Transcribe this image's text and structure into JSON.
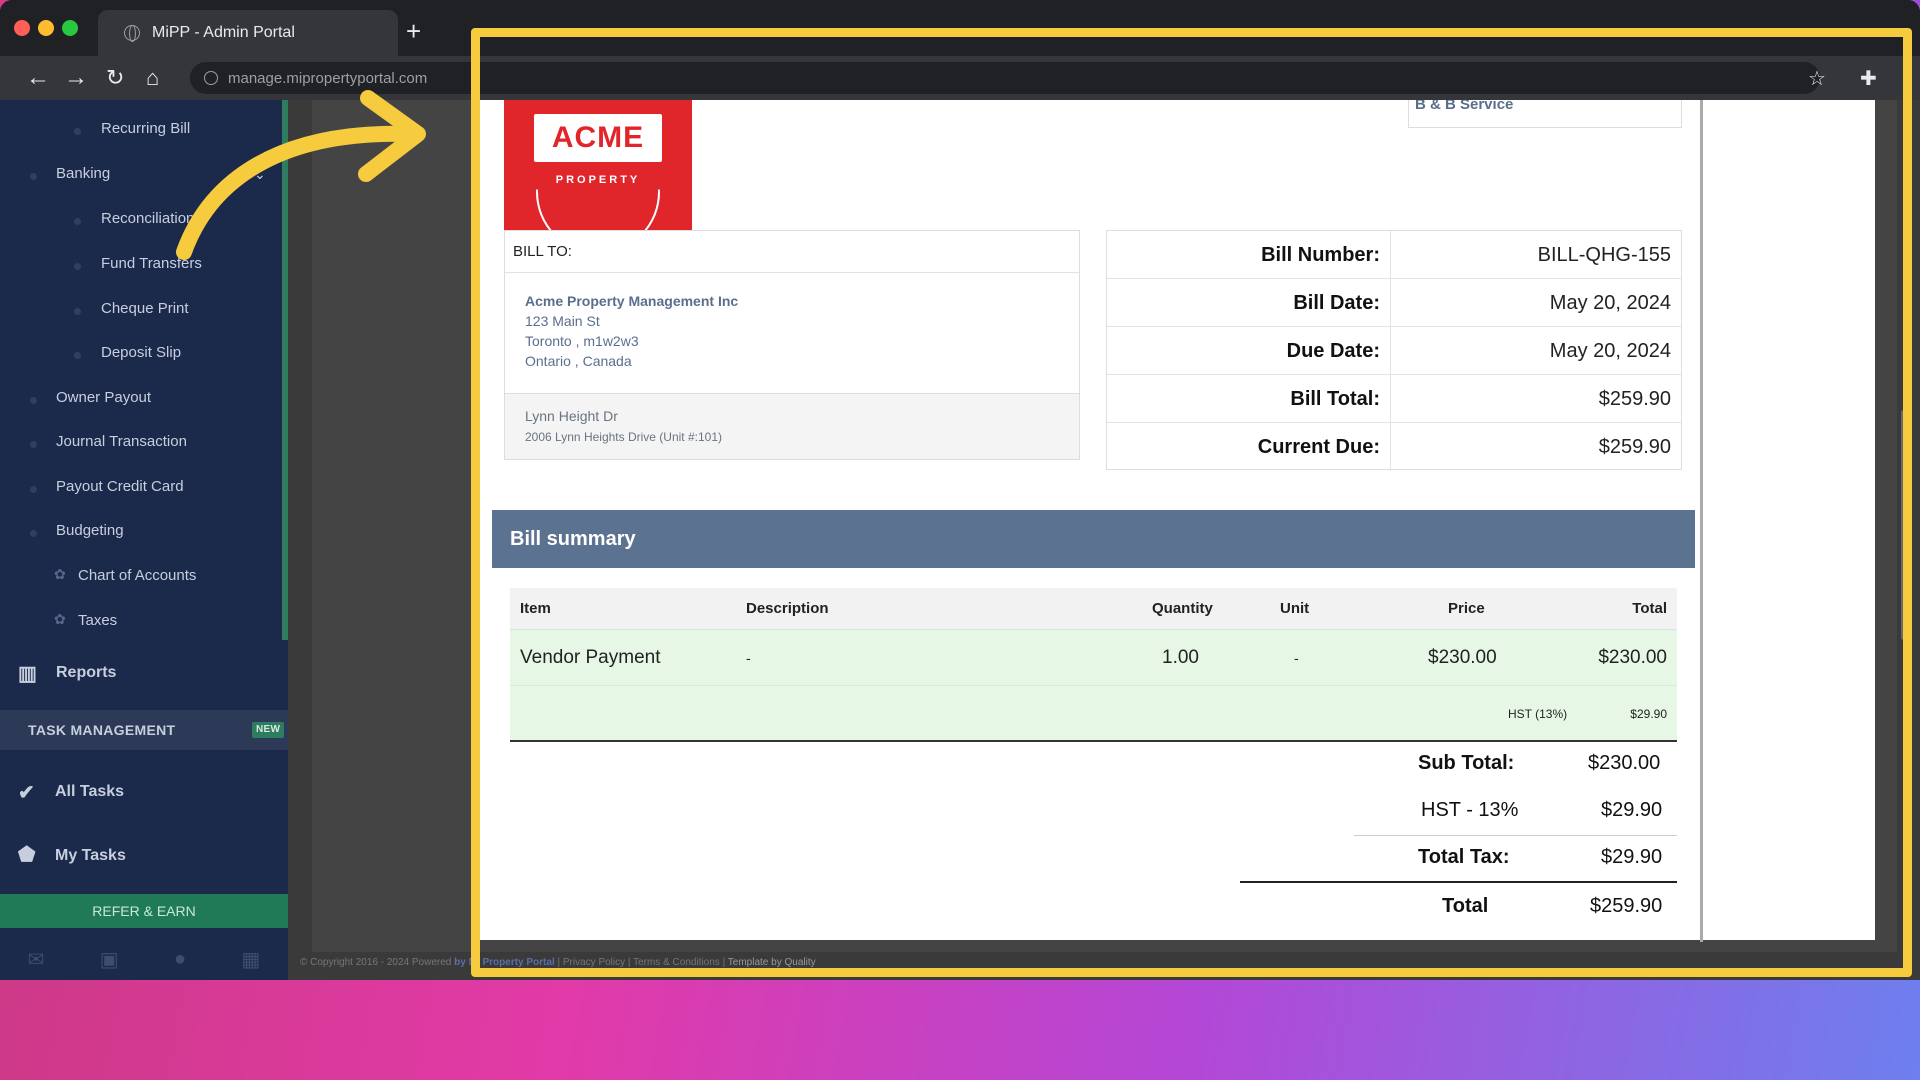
{
  "browser": {
    "tab_title": "MiPP - Admin Portal",
    "url": "manage.mipropertyportal.com"
  },
  "sidebar": {
    "items": [
      {
        "label": "Recurring Bill"
      },
      {
        "label": "Banking"
      },
      {
        "label": "Reconciliation"
      },
      {
        "label": "Fund Transfers"
      },
      {
        "label": "Cheque Print"
      },
      {
        "label": "Deposit Slip"
      },
      {
        "label": "Owner Payout"
      },
      {
        "label": "Journal Transaction"
      },
      {
        "label": "Payout Credit Card"
      },
      {
        "label": "Budgeting"
      },
      {
        "label": "Chart of Accounts"
      },
      {
        "label": "Taxes"
      }
    ],
    "reports": "Reports",
    "task_header": "TASK MANAGEMENT",
    "task_badge": "NEW",
    "all_tasks": "All Tasks",
    "my_tasks": "My Tasks",
    "refer": "REFER & EARN"
  },
  "footer": {
    "copyright": "© Copyright 2016 - 2024 Powered",
    "brand": "by Mi Property Portal",
    "links": "| Privacy Policy | Terms & Conditions |",
    "template": "Template by Quality"
  },
  "bill": {
    "logo_text": "ACME",
    "logo_sub": "PROPERTY",
    "vendor": "B & B Service",
    "bill_to_label": "BILL TO:",
    "bill_to": {
      "name": "Acme Property Management Inc",
      "street": "123 Main St",
      "city": "Toronto , m1w2w3",
      "region": "Ontario , Canada"
    },
    "property": {
      "name": "Lynn Height Dr",
      "address": "2006 Lynn Heights Drive (Unit #:101)"
    },
    "info": [
      {
        "label": "Bill Number:",
        "value": "BILL-QHG-155"
      },
      {
        "label": "Bill Date:",
        "value": "May 20, 2024"
      },
      {
        "label": "Due Date:",
        "value": "May 20, 2024"
      },
      {
        "label": "Bill Total:",
        "value": "$259.90"
      },
      {
        "label": "Current Due:",
        "value": "$259.90"
      }
    ],
    "summary_title": "Bill summary",
    "columns": [
      "Item",
      "Description",
      "Quantity",
      "Unit",
      "Price",
      "Total"
    ],
    "line_item": {
      "item": "Vendor Payment",
      "description": "-",
      "quantity": "1.00",
      "unit": "-",
      "price": "$230.00",
      "total": "$230.00"
    },
    "tax_line": {
      "label": "HST (13%)",
      "value": "$29.90"
    },
    "totals": {
      "sub_total_label": "Sub Total:",
      "sub_total": "$230.00",
      "hst_label": "HST - 13%",
      "hst": "$29.90",
      "total_tax_label": "Total Tax:",
      "total_tax": "$29.90",
      "total_label": "Total",
      "total": "$259.90"
    }
  },
  "colors": {
    "highlight": "#f7cb3e",
    "sidebar": "#1b2a4a",
    "summary_header": "#5b7290",
    "logo_red": "#e1262b",
    "row_green": "#e6f7e6"
  }
}
